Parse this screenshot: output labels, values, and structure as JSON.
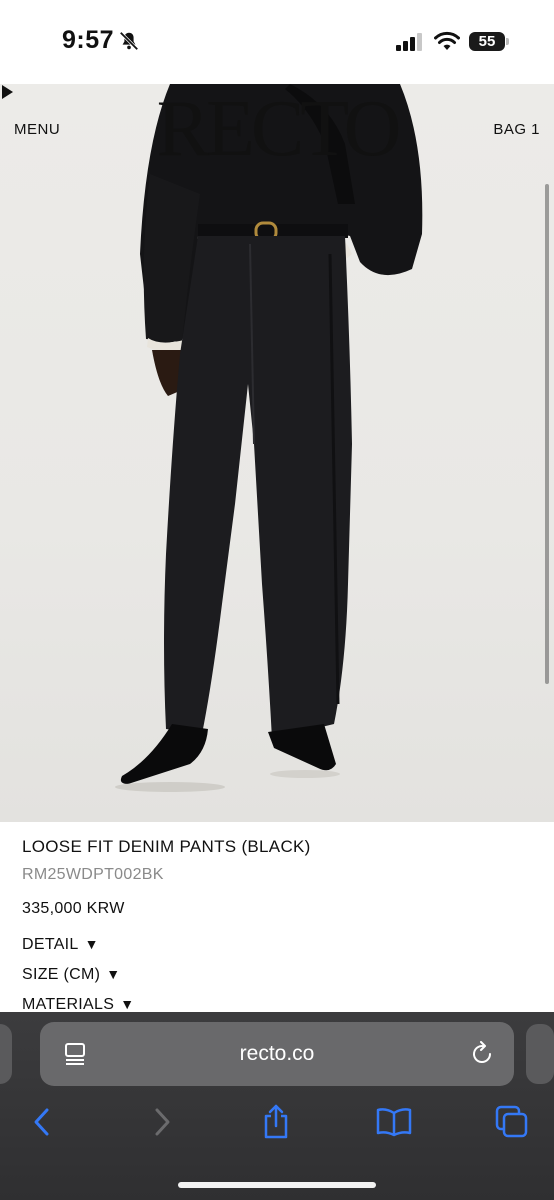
{
  "status_bar": {
    "time": "9:57",
    "battery": "55",
    "icons": [
      "bell-slash-icon",
      "cellular-signal-icon",
      "wifi-icon",
      "battery-icon"
    ]
  },
  "site": {
    "menu_label": "MENU",
    "logo": "RECTO",
    "bag_label": "BAG 1"
  },
  "product": {
    "name": "LOOSE FIT DENIM PANTS (BLACK)",
    "sku": "RM25WDPT002BK",
    "price": "335,000 KRW",
    "sections": [
      {
        "label": "DETAIL",
        "icon": "triangle-down-icon"
      },
      {
        "label": "SIZE (CM)",
        "icon": "triangle-down-icon"
      },
      {
        "label": "MATERIALS",
        "icon": "triangle-down-icon"
      }
    ]
  },
  "browser": {
    "url": "recto.co",
    "toolbar": [
      "back-icon",
      "forward-icon",
      "share-icon",
      "bookmarks-icon",
      "tabs-icon"
    ]
  },
  "colors": {
    "accent": "#3478f6",
    "toolbar_bg": "#353537"
  }
}
